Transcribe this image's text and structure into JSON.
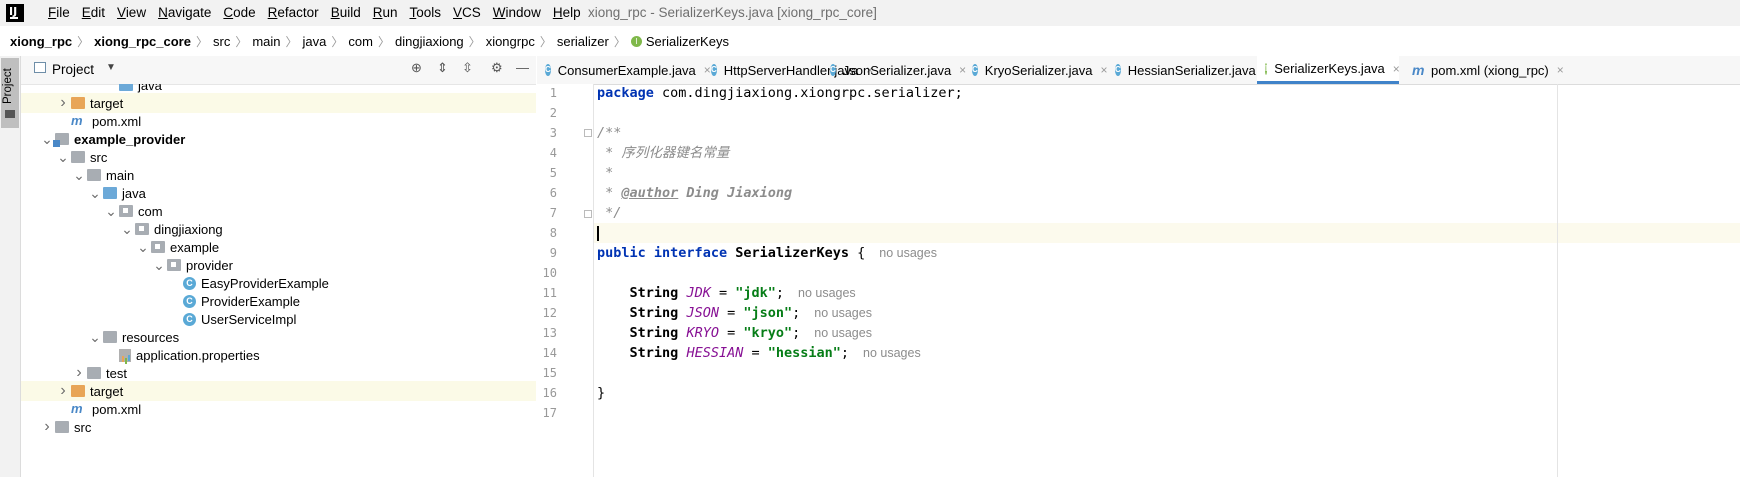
{
  "menu": {
    "items": [
      "File",
      "Edit",
      "View",
      "Navigate",
      "Code",
      "Refactor",
      "Build",
      "Run",
      "Tools",
      "VCS",
      "Window",
      "Help"
    ],
    "window_title": "xiong_rpc - SerializerKeys.java [xiong_rpc_core]"
  },
  "breadcrumbs": [
    "xiong_rpc",
    "xiong_rpc_core",
    "src",
    "main",
    "java",
    "com",
    "dingjiaxiong",
    "xiongrpc",
    "serializer",
    "SerializerKeys"
  ],
  "tool_strip": {
    "project_label": "Project"
  },
  "project_panel": {
    "title": "Project",
    "tree": [
      {
        "label": "java",
        "indent": 5,
        "arrow": "",
        "icon": "folder-blue",
        "hl": false,
        "partial": true
      },
      {
        "label": "target",
        "indent": 2,
        "arrow": ">",
        "icon": "folder-orange",
        "hl": true
      },
      {
        "label": "pom.xml",
        "indent": 2,
        "arrow": "",
        "icon": "maven",
        "hl": false
      },
      {
        "label": "example_provider",
        "indent": 1,
        "arrow": "v",
        "icon": "module",
        "hl": false,
        "bold": true
      },
      {
        "label": "src",
        "indent": 2,
        "arrow": "v",
        "icon": "folder",
        "hl": false
      },
      {
        "label": "main",
        "indent": 3,
        "arrow": "v",
        "icon": "folder",
        "hl": false
      },
      {
        "label": "java",
        "indent": 4,
        "arrow": "v",
        "icon": "folder-blue",
        "hl": false
      },
      {
        "label": "com",
        "indent": 5,
        "arrow": "v",
        "icon": "pkg",
        "hl": false
      },
      {
        "label": "dingjiaxiong",
        "indent": 6,
        "arrow": "v",
        "icon": "pkg",
        "hl": false
      },
      {
        "label": "example",
        "indent": 7,
        "arrow": "v",
        "icon": "pkg",
        "hl": false
      },
      {
        "label": "provider",
        "indent": 8,
        "arrow": "v",
        "icon": "pkg",
        "hl": false
      },
      {
        "label": "EasyProviderExample",
        "indent": 9,
        "arrow": "",
        "icon": "cls",
        "hl": false
      },
      {
        "label": "ProviderExample",
        "indent": 9,
        "arrow": "",
        "icon": "cls",
        "hl": false
      },
      {
        "label": "UserServiceImpl",
        "indent": 9,
        "arrow": "",
        "icon": "cls",
        "hl": false
      },
      {
        "label": "resources",
        "indent": 4,
        "arrow": "v",
        "icon": "folder-res",
        "hl": false
      },
      {
        "label": "application.properties",
        "indent": 5,
        "arrow": "",
        "icon": "props",
        "hl": false
      },
      {
        "label": "test",
        "indent": 3,
        "arrow": ">",
        "icon": "folder",
        "hl": false
      },
      {
        "label": "target",
        "indent": 2,
        "arrow": ">",
        "icon": "folder-orange",
        "hl": true
      },
      {
        "label": "pom.xml",
        "indent": 2,
        "arrow": "",
        "icon": "maven",
        "hl": false
      },
      {
        "label": "src",
        "indent": 1,
        "arrow": ">",
        "icon": "folder",
        "hl": false
      }
    ]
  },
  "tabs": [
    {
      "label": "ConsumerExample.java",
      "kind": "class",
      "closable": true,
      "active": false
    },
    {
      "label": "HttpServerHandler.java",
      "kind": "class",
      "closable": true,
      "active": false
    },
    {
      "label": "JsonSerializer.java",
      "kind": "class",
      "closable": true,
      "active": false
    },
    {
      "label": "KryoSerializer.java",
      "kind": "class",
      "closable": true,
      "active": false
    },
    {
      "label": "HessianSerializer.java",
      "kind": "class",
      "closable": true,
      "active": false
    },
    {
      "label": "SerializerKeys.java",
      "kind": "interface",
      "closable": true,
      "active": true
    },
    {
      "label": "pom.xml (xiong_rpc)",
      "kind": "maven",
      "closable": true,
      "active": false
    }
  ],
  "editor": {
    "line_numbers": [
      "1",
      "2",
      "3",
      "4",
      "5",
      "6",
      "7",
      "8",
      "9",
      "10",
      "11",
      "12",
      "13",
      "14",
      "15",
      "16",
      "17"
    ],
    "code": {
      "l1_kw": "package",
      "l1_rest": " com.dingjiaxiong.xiongrpc.serializer;",
      "l3": "/**",
      "l4": " * 序列化器键名常量",
      "l5": " *",
      "l6_pre": " * ",
      "l6_tag": "@author",
      "l6_rest": " Ding Jiaxiong",
      "l7": " */",
      "l9_kw1": "public",
      "l9_kw2": "interface",
      "l9_name": "SerializerKeys",
      "l9_brace": " {",
      "l11_const": "JDK",
      "l11_str": "\"jdk\"",
      "l12_const": "JSON",
      "l12_str": "\"json\"",
      "l13_const": "KRYO",
      "l13_str": "\"kryo\"",
      "l14_const": "HESSIAN",
      "l14_str": "\"hessian\"",
      "l16": "}",
      "type_name": "String",
      "eq": " = ",
      "semi": ";"
    },
    "hint_no_usages": "no usages"
  }
}
